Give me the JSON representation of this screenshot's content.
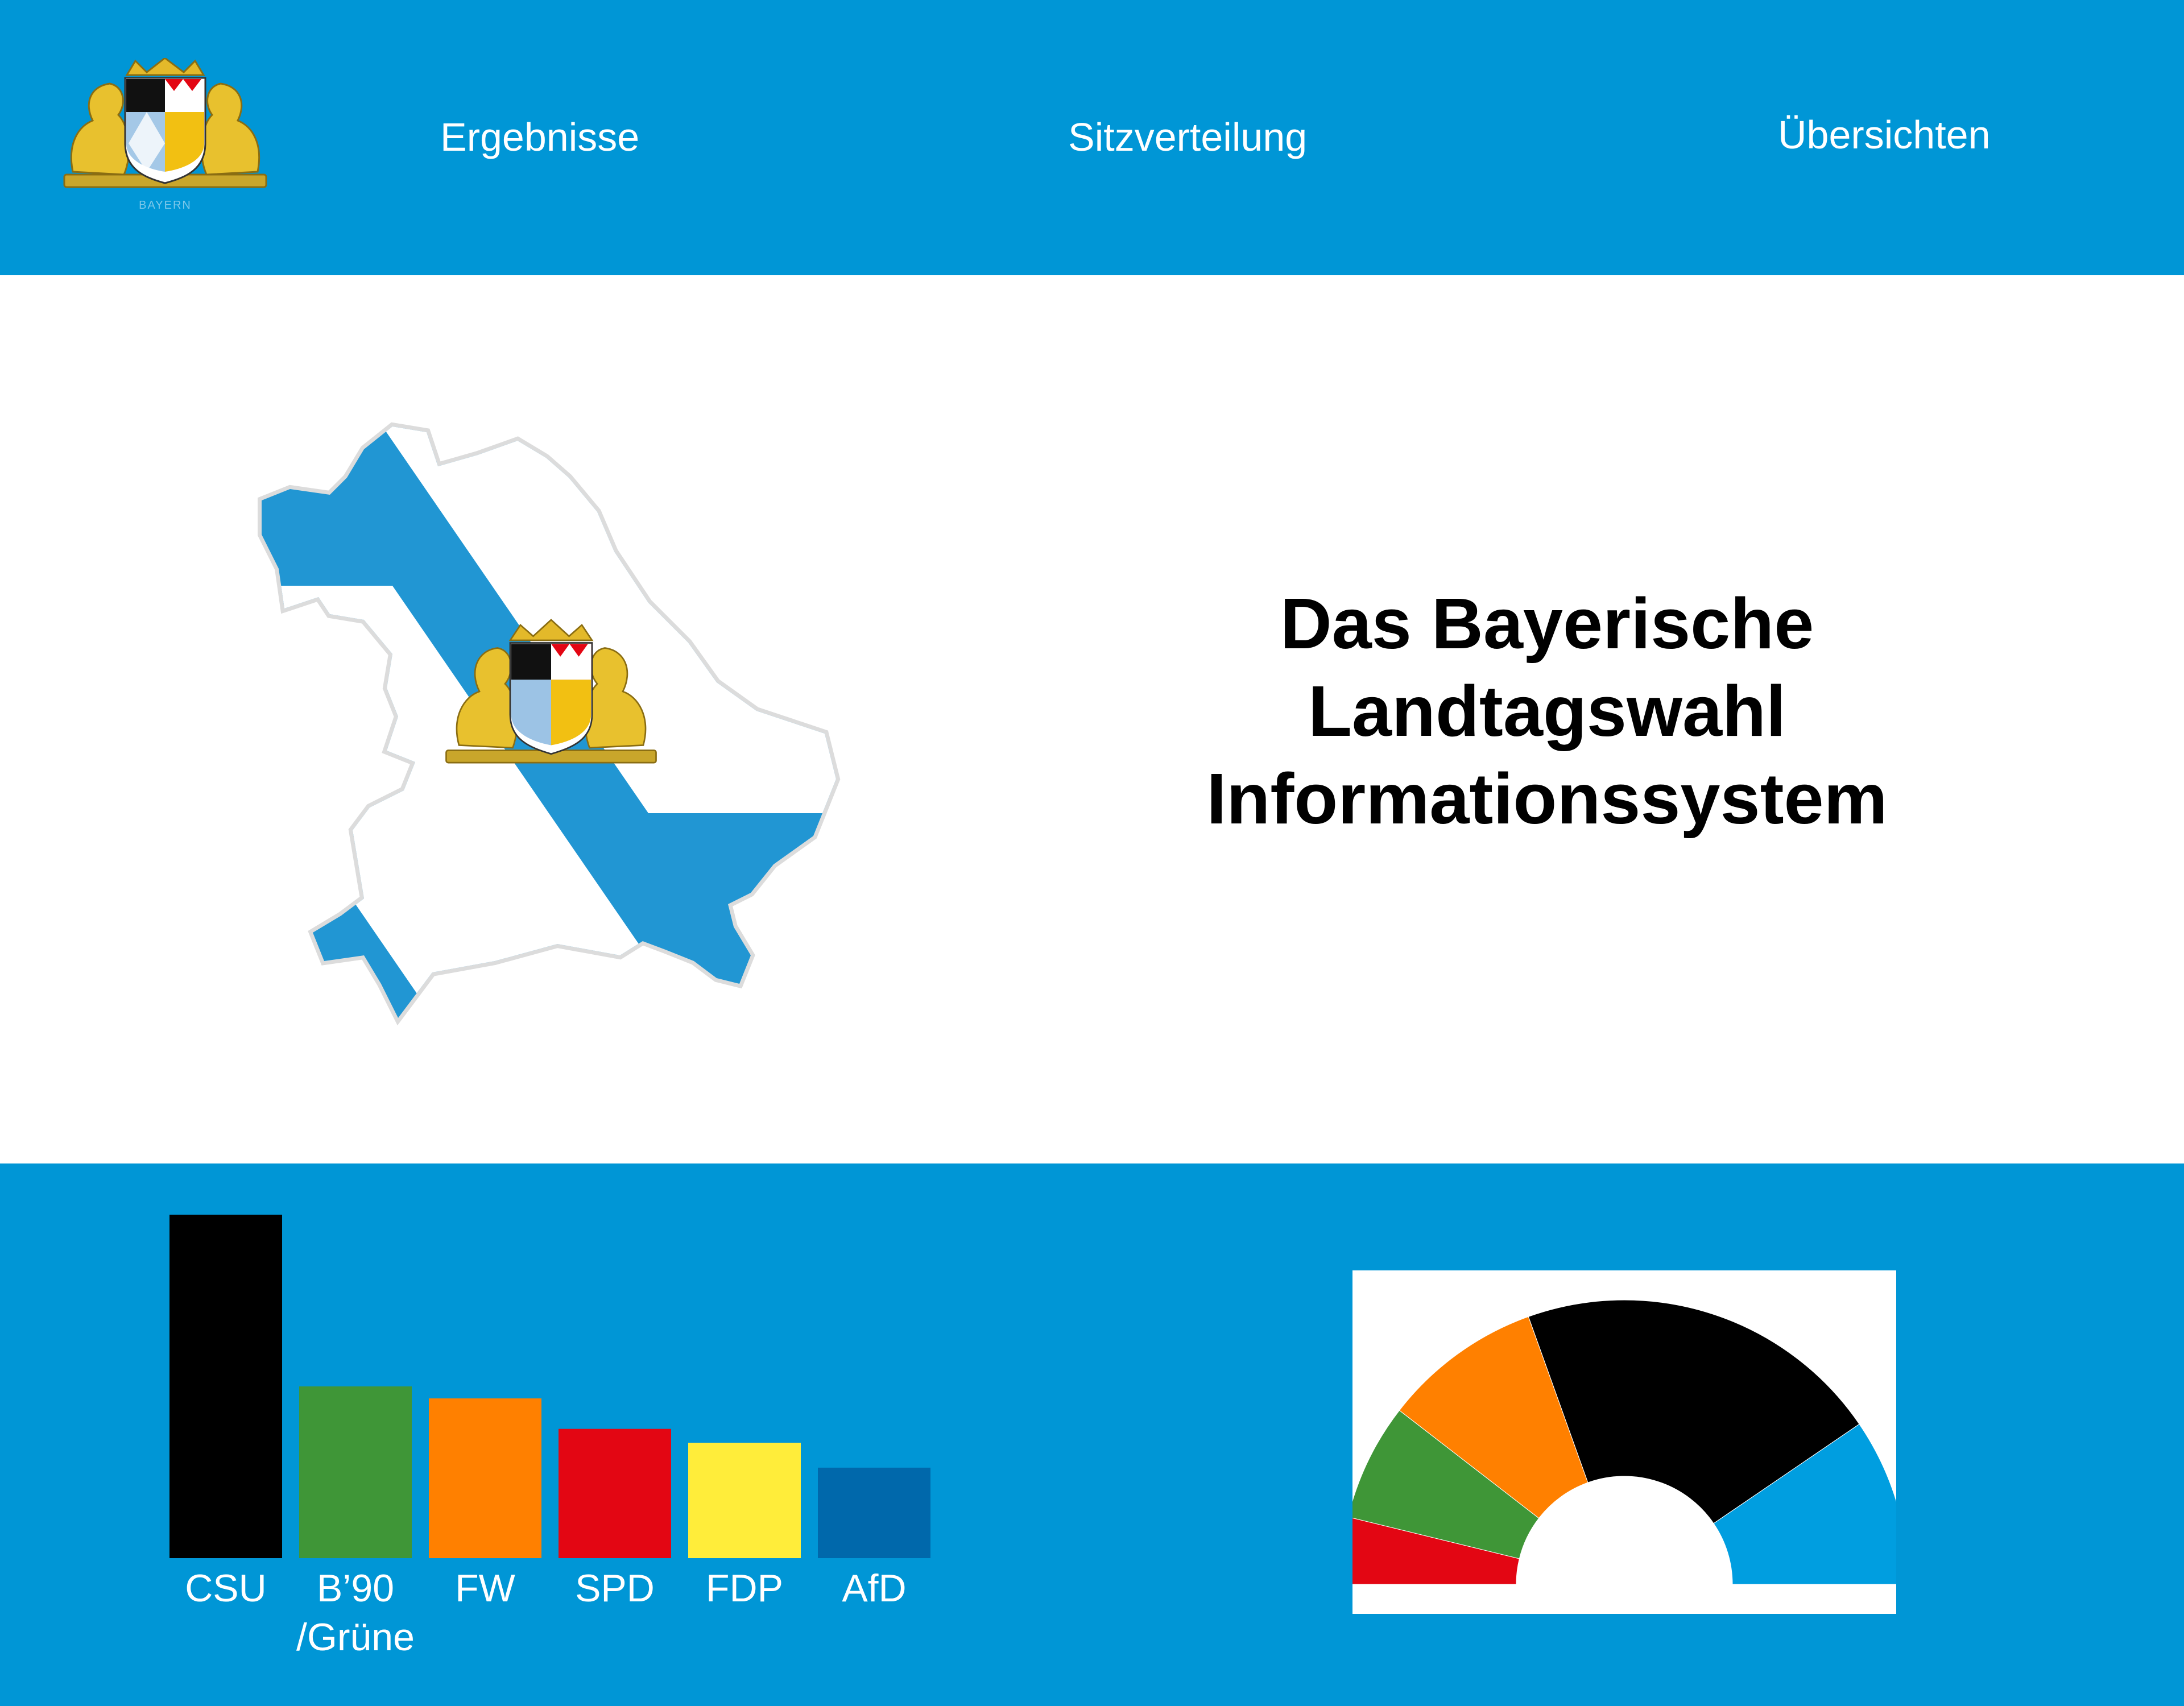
{
  "header": {
    "logo_caption": "BAYERN",
    "nav": [
      {
        "label": "Ergebnisse"
      },
      {
        "label": "Sitzverteilung"
      },
      {
        "label": "Übersichten"
      }
    ]
  },
  "hero": {
    "title_lines": [
      "Das Bayerische",
      "Landtagswahl",
      "Informationssystem"
    ]
  },
  "colors": {
    "brand_blue": "#0096d6",
    "map_blue": "#2196d3",
    "CSU": "#000000",
    "B90_Gruene": "#3f9637",
    "FW": "#ff8000",
    "SPD": "#e30613",
    "FDP": "#ffed3a",
    "AfD": "#0068ab"
  },
  "chart_data": [
    {
      "type": "bar",
      "title": "",
      "xlabel": "",
      "ylabel": "",
      "categories": [
        "CSU",
        "B’90 /Grüne",
        "FW",
        "SPD",
        "FDP",
        "AfD"
      ],
      "category_lines": [
        [
          "CSU"
        ],
        [
          "B’90",
          "/Grüne"
        ],
        [
          "FW"
        ],
        [
          "SPD"
        ],
        [
          "FDP"
        ],
        [
          "AfD"
        ]
      ],
      "values": [
        37.2,
        18.6,
        17.3,
        14.0,
        12.5,
        9.8
      ],
      "colors": [
        "#000000",
        "#3f9637",
        "#ff8000",
        "#e30613",
        "#ffed3a",
        "#0068ab"
      ],
      "ylim": [
        0,
        37.2
      ],
      "grid": false,
      "legend": "none"
    },
    {
      "type": "pie",
      "title": "",
      "variant": "semicircle",
      "slices": [
        {
          "label": "SPD",
          "value": 8,
          "color": "#e30613"
        },
        {
          "label": "B’90 /Grüne",
          "value": 14,
          "color": "#3f9637"
        },
        {
          "label": "FW",
          "value": 19,
          "color": "#ff8000"
        },
        {
          "label": "CSU",
          "value": 44,
          "color": "#000000"
        },
        {
          "label": "AfD",
          "value": 20,
          "color": "#009ee0"
        }
      ],
      "legend": "none"
    }
  ]
}
